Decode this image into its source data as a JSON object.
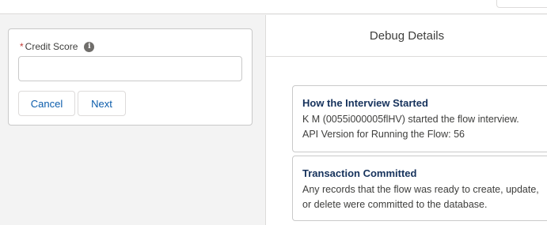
{
  "form": {
    "field_label": "Credit Score",
    "required_marker": "*",
    "info_icon": "i",
    "input_value": "",
    "cancel_label": "Cancel",
    "next_label": "Next"
  },
  "debug": {
    "title": "Debug Details",
    "cards": [
      {
        "title": "How the Interview Started",
        "lines": [
          "K M (0055i000005flHV) started the flow interview.",
          "API Version for Running the Flow: 56"
        ]
      },
      {
        "title": "Transaction Committed",
        "lines": [
          "Any records that the flow was ready to create, update,",
          "or delete were committed to the database."
        ]
      }
    ]
  },
  "colors": {
    "link_blue": "#0b5cab",
    "required_red": "#c23934",
    "title_navy": "#16325c"
  }
}
